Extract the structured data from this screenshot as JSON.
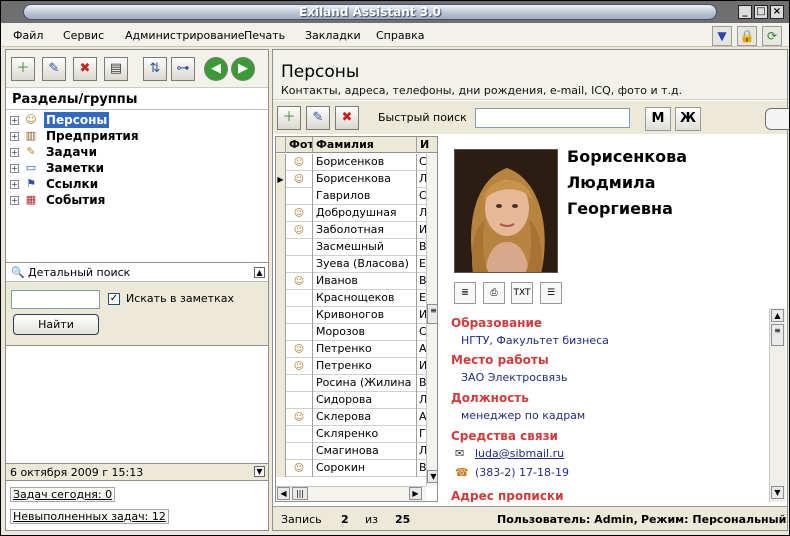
{
  "window": {
    "title": "Exiland Assistant 3.0"
  },
  "menu": [
    "Файл",
    "Сервис",
    "Администрирование",
    "Печать",
    "Закладки",
    "Справка"
  ],
  "left": {
    "section_title": "Разделы/группы",
    "tree": [
      {
        "label": "Персоны",
        "icon": "person-icon",
        "selected": true
      },
      {
        "label": "Предприятия",
        "icon": "building-icon",
        "selected": false
      },
      {
        "label": "Задачи",
        "icon": "task-icon",
        "selected": false
      },
      {
        "label": "Заметки",
        "icon": "note-icon",
        "selected": false
      },
      {
        "label": "Ссылки",
        "icon": "link-icon",
        "selected": false
      },
      {
        "label": "События",
        "icon": "calendar-icon",
        "selected": false
      }
    ],
    "search": {
      "title": "Детальный поиск",
      "input_value": "",
      "checkbox_label": "Искать в заметках",
      "checkbox_checked": true,
      "button_label": "Найти"
    },
    "status_date": "6 октября 2009 г  15:13",
    "tasks_today": "Задач сегодня: 0",
    "tasks_unfinished": "Невыполненных задач: 12"
  },
  "right": {
    "title": "Персоны",
    "subtitle": "Контакты, адреса, телефоны, дни рождения, e-mail, ICQ, фото и т.д.",
    "quick_search_label": "Быстрый поиск",
    "quick_search_value": "",
    "gender_m": "М",
    "gender_f": "Ж",
    "columns": {
      "photo": "Фот",
      "surname": "Фамилия",
      "initial": "И"
    },
    "rows": [
      {
        "photo": true,
        "surname": "Борисенков",
        "initial": "С",
        "selected": false
      },
      {
        "photo": true,
        "surname": "Борисенкова",
        "initial": "Л",
        "selected": true
      },
      {
        "photo": false,
        "surname": "Гаврилов",
        "initial": "С",
        "selected": false
      },
      {
        "photo": true,
        "surname": "Добродушная",
        "initial": "Л",
        "selected": false
      },
      {
        "photo": true,
        "surname": "Заболотная",
        "initial": "И",
        "selected": false
      },
      {
        "photo": false,
        "surname": "Засмешный",
        "initial": "В",
        "selected": false
      },
      {
        "photo": false,
        "surname": "Зуева (Власова)",
        "initial": "Е",
        "selected": false
      },
      {
        "photo": true,
        "surname": "Иванов",
        "initial": "В",
        "selected": false
      },
      {
        "photo": false,
        "surname": "Краснощеков",
        "initial": "Е",
        "selected": false
      },
      {
        "photo": false,
        "surname": "Кривоногов",
        "initial": "И",
        "selected": false
      },
      {
        "photo": false,
        "surname": "Морозов",
        "initial": "С",
        "selected": false
      },
      {
        "photo": true,
        "surname": "Петренко",
        "initial": "А",
        "selected": false
      },
      {
        "photo": true,
        "surname": "Петренко",
        "initial": "И",
        "selected": false
      },
      {
        "photo": false,
        "surname": "Росина (Жилина",
        "initial": "В",
        "selected": false
      },
      {
        "photo": false,
        "surname": "Сидорова",
        "initial": "Л",
        "selected": false
      },
      {
        "photo": true,
        "surname": "Склерова",
        "initial": "А",
        "selected": false
      },
      {
        "photo": false,
        "surname": "Скляренко",
        "initial": "Г",
        "selected": false
      },
      {
        "photo": false,
        "surname": "Смагинова",
        "initial": "Л",
        "selected": false
      },
      {
        "photo": true,
        "surname": "Сорокин",
        "initial": "В",
        "selected": false
      }
    ],
    "person": {
      "surname": "Борисенкова",
      "name": "Людмила",
      "patronymic": "Георгиевна",
      "action_icons": [
        "info-icon",
        "print-icon",
        "TXT",
        "list-icon"
      ],
      "education_label": "Образование",
      "education": "НГТУ, Факультет бизнеса",
      "work_label": "Место работы",
      "work": "ЗАО Электросвязь",
      "position_label": "Должность",
      "position": "менеджер по кадрам",
      "contacts_label": "Средства связи",
      "email": "luda@sibmail.ru",
      "phone": "(383-2) 17-18-19",
      "address_label": "Адрес прописки"
    },
    "status": {
      "record_label": "Запись",
      "record_current": "2",
      "of_label": "из",
      "record_total": "25",
      "user": "Пользователь: Admin,",
      "mode": "Режим: Персональный"
    }
  },
  "colors": {
    "selection": "#316ac5",
    "label_red": "#d33b3b",
    "value_blue": "#1d2b8a"
  }
}
